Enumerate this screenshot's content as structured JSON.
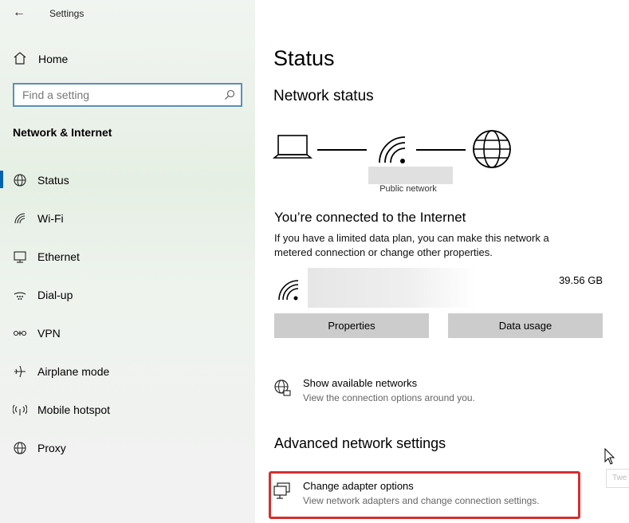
{
  "window": {
    "title": "Settings"
  },
  "sidebar": {
    "home_label": "Home",
    "search_placeholder": "Find a setting",
    "section_title": "Network & Internet",
    "items": [
      {
        "label": "Status",
        "icon": "globe-icon",
        "active": true
      },
      {
        "label": "Wi-Fi",
        "icon": "wifi-icon"
      },
      {
        "label": "Ethernet",
        "icon": "ethernet-icon"
      },
      {
        "label": "Dial-up",
        "icon": "dialup-icon"
      },
      {
        "label": "VPN",
        "icon": "vpn-icon"
      },
      {
        "label": "Airplane mode",
        "icon": "airplane-icon"
      },
      {
        "label": "Mobile hotspot",
        "icon": "hotspot-icon"
      },
      {
        "label": "Proxy",
        "icon": "globe-icon"
      }
    ]
  },
  "main": {
    "title": "Status",
    "network_status_heading": "Network status",
    "network_type": "Public network",
    "connected_heading": "You’re connected to the Internet",
    "connected_desc_line1": "If you have a limited data plan, you can make this network a",
    "connected_desc_line2": "metered connection or change other properties.",
    "data_usage_amount": "39.56 GB",
    "properties_button": "Properties",
    "data_usage_button": "Data usage",
    "show_networks": {
      "title": "Show available networks",
      "subtitle": "View the connection options around you."
    },
    "advanced_heading": "Advanced network settings",
    "change_adapter": {
      "title": "Change adapter options",
      "subtitle": "View network adapters and change connection settings."
    },
    "tooltip_fragment": "Twe"
  },
  "colors": {
    "accent": "#0063b1",
    "highlight_border": "#d42f2f",
    "button_bg": "#cccccc"
  }
}
